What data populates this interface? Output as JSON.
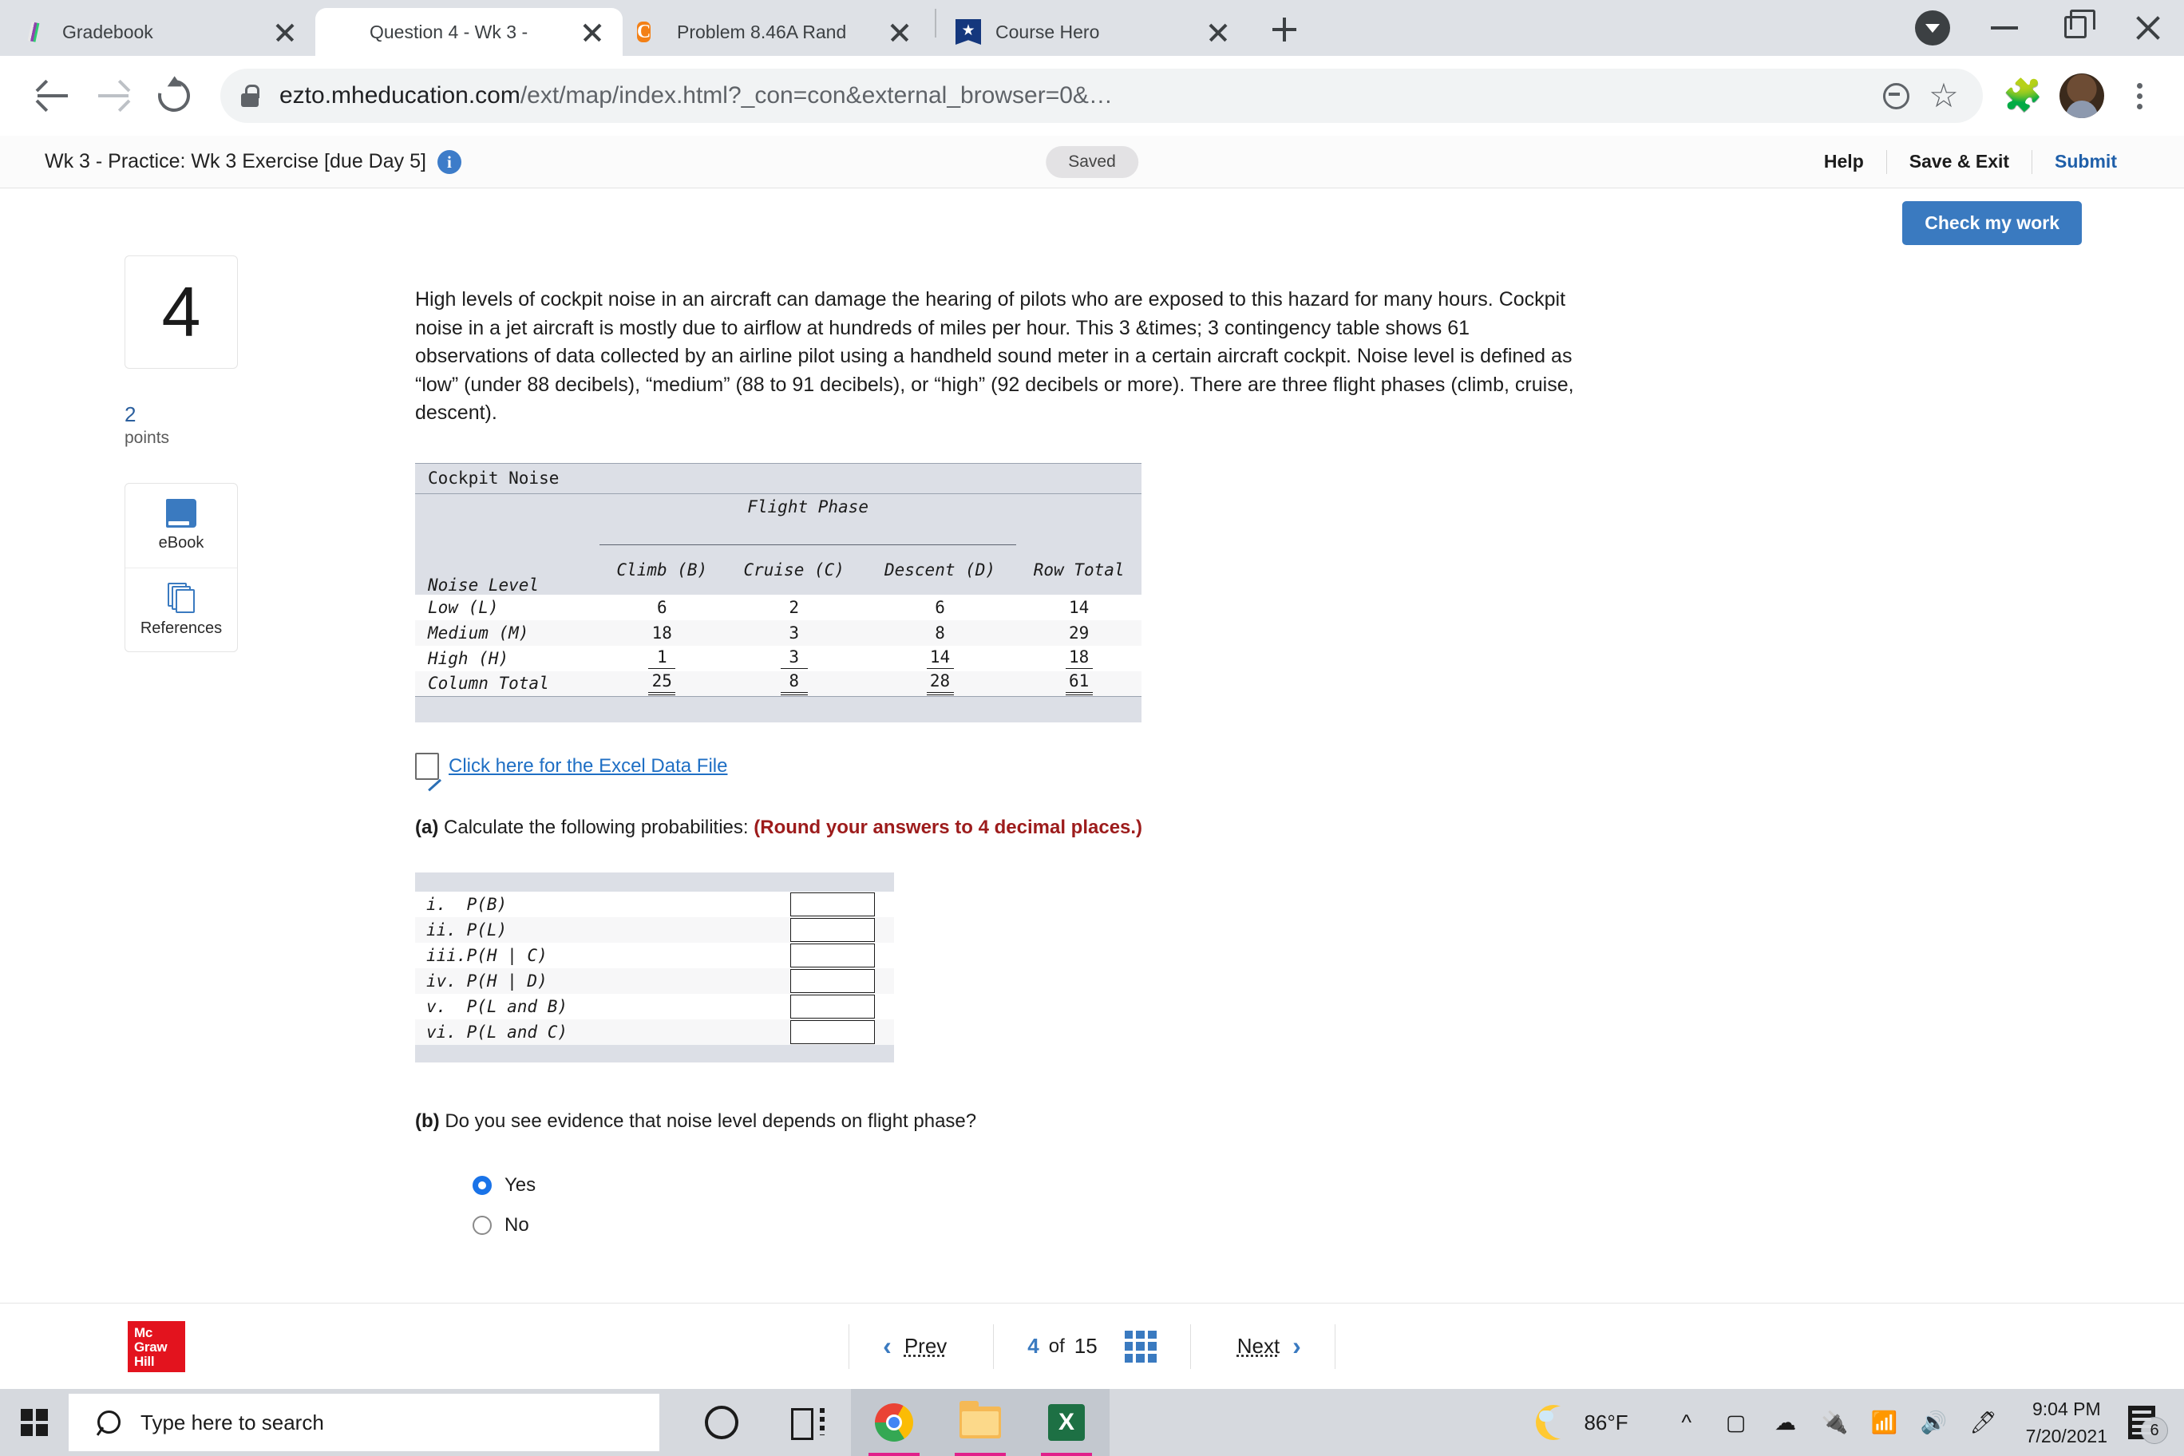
{
  "browser": {
    "tabs": [
      {
        "title": "Gradebook",
        "favicon": "gradebook-icon",
        "active": false
      },
      {
        "title": "Question 4 - Wk 3 -",
        "favicon": "globe-icon",
        "active": true
      },
      {
        "title": "Problem 8.46A Rand",
        "favicon": "chegg-icon",
        "active": false
      },
      {
        "title": "Course Hero",
        "favicon": "course-hero-icon",
        "active": false
      }
    ],
    "new_tab_label": "+",
    "url_bold": "ezto.mheducation.com",
    "url_rest": "/ext/map/index.html?_con=con&external_browser=0&…",
    "window_controls": {
      "profile": "profile-caret",
      "minimize": "—",
      "maximize": "□",
      "close": "✕"
    }
  },
  "header": {
    "title": "Wk 3 - Practice: Wk 3 Exercise [due Day 5]",
    "info_glyph": "i",
    "saved_badge": "Saved",
    "help": "Help",
    "save_exit": "Save & Exit",
    "submit": "Submit",
    "check_my_work": "Check my work"
  },
  "rail": {
    "question_number": "4",
    "points_value": "2",
    "points_label": "points",
    "ebook_label": "eBook",
    "references_label": "References"
  },
  "question": {
    "text": "High levels of cockpit noise in an aircraft can damage the hearing of pilots who are exposed to this hazard for many hours. Cockpit noise in a jet aircraft is mostly due to airflow at hundreds of miles per hour. This 3 &times; 3 contingency table shows 61 observations of data collected by an airline pilot using a handheld sound meter in a certain aircraft cockpit. Noise level is defined as “low” (under 88 decibels), “medium” (88 to 91 decibels), or “high” (92 decibels or more). There are three flight phases (climb, cruise, descent).",
    "excel_link": "Click here for the Excel Data File",
    "part_a_prefix": "(a)",
    "part_a_text": "Calculate the following probabilities:",
    "part_a_note": "(Round your answers to 4 decimal places.)",
    "part_b_prefix": "(b)",
    "part_b_text": "Do you see evidence that noise level depends on flight phase?",
    "answers": [
      {
        "roman": "i.",
        "label": "P(B)",
        "value": ""
      },
      {
        "roman": "ii.",
        "label": "P(L)",
        "value": ""
      },
      {
        "roman": "iii.",
        "label": "P(H | C)",
        "value": ""
      },
      {
        "roman": "iv.",
        "label": "P(H | D)",
        "value": ""
      },
      {
        "roman": "v.",
        "label": "P(L and B)",
        "value": ""
      },
      {
        "roman": "vi.",
        "label": "P(L and C)",
        "value": ""
      }
    ],
    "radio_options": [
      {
        "label": "Yes",
        "selected": true
      },
      {
        "label": "No",
        "selected": false
      }
    ]
  },
  "chart_data": {
    "type": "table",
    "title": "Cockpit Noise",
    "group_header": "Flight Phase",
    "row_label_header": "Noise Level",
    "categories": [
      "Climb (B)",
      "Cruise (C)",
      "Descent (D)"
    ],
    "total_header": "Row Total",
    "rows": [
      {
        "name": "Low (L)",
        "values": [
          6,
          2,
          6
        ],
        "total": 14
      },
      {
        "name": "Medium (M)",
        "values": [
          18,
          3,
          8
        ],
        "total": 29
      },
      {
        "name": "High (H)",
        "values": [
          1,
          3,
          14
        ],
        "total": 18
      }
    ],
    "column_total_label": "Column Total",
    "column_totals": [
      25,
      8,
      28
    ],
    "grand_total": 61
  },
  "footer": {
    "logo_line1": "Mc",
    "logo_line2": "Graw",
    "logo_line3": "Hill",
    "prev": "Prev",
    "page_current": "4",
    "page_of": "of",
    "page_total": "15",
    "next": "Next"
  },
  "taskbar": {
    "search_placeholder": "Type here to search",
    "apps": [
      "cortana-icon",
      "task-view-icon",
      "chrome-icon",
      "file-explorer-icon",
      "excel-icon"
    ],
    "weather_temp": "86°F",
    "time": "9:04 PM",
    "date": "7/20/2021",
    "notification_count": "6"
  }
}
